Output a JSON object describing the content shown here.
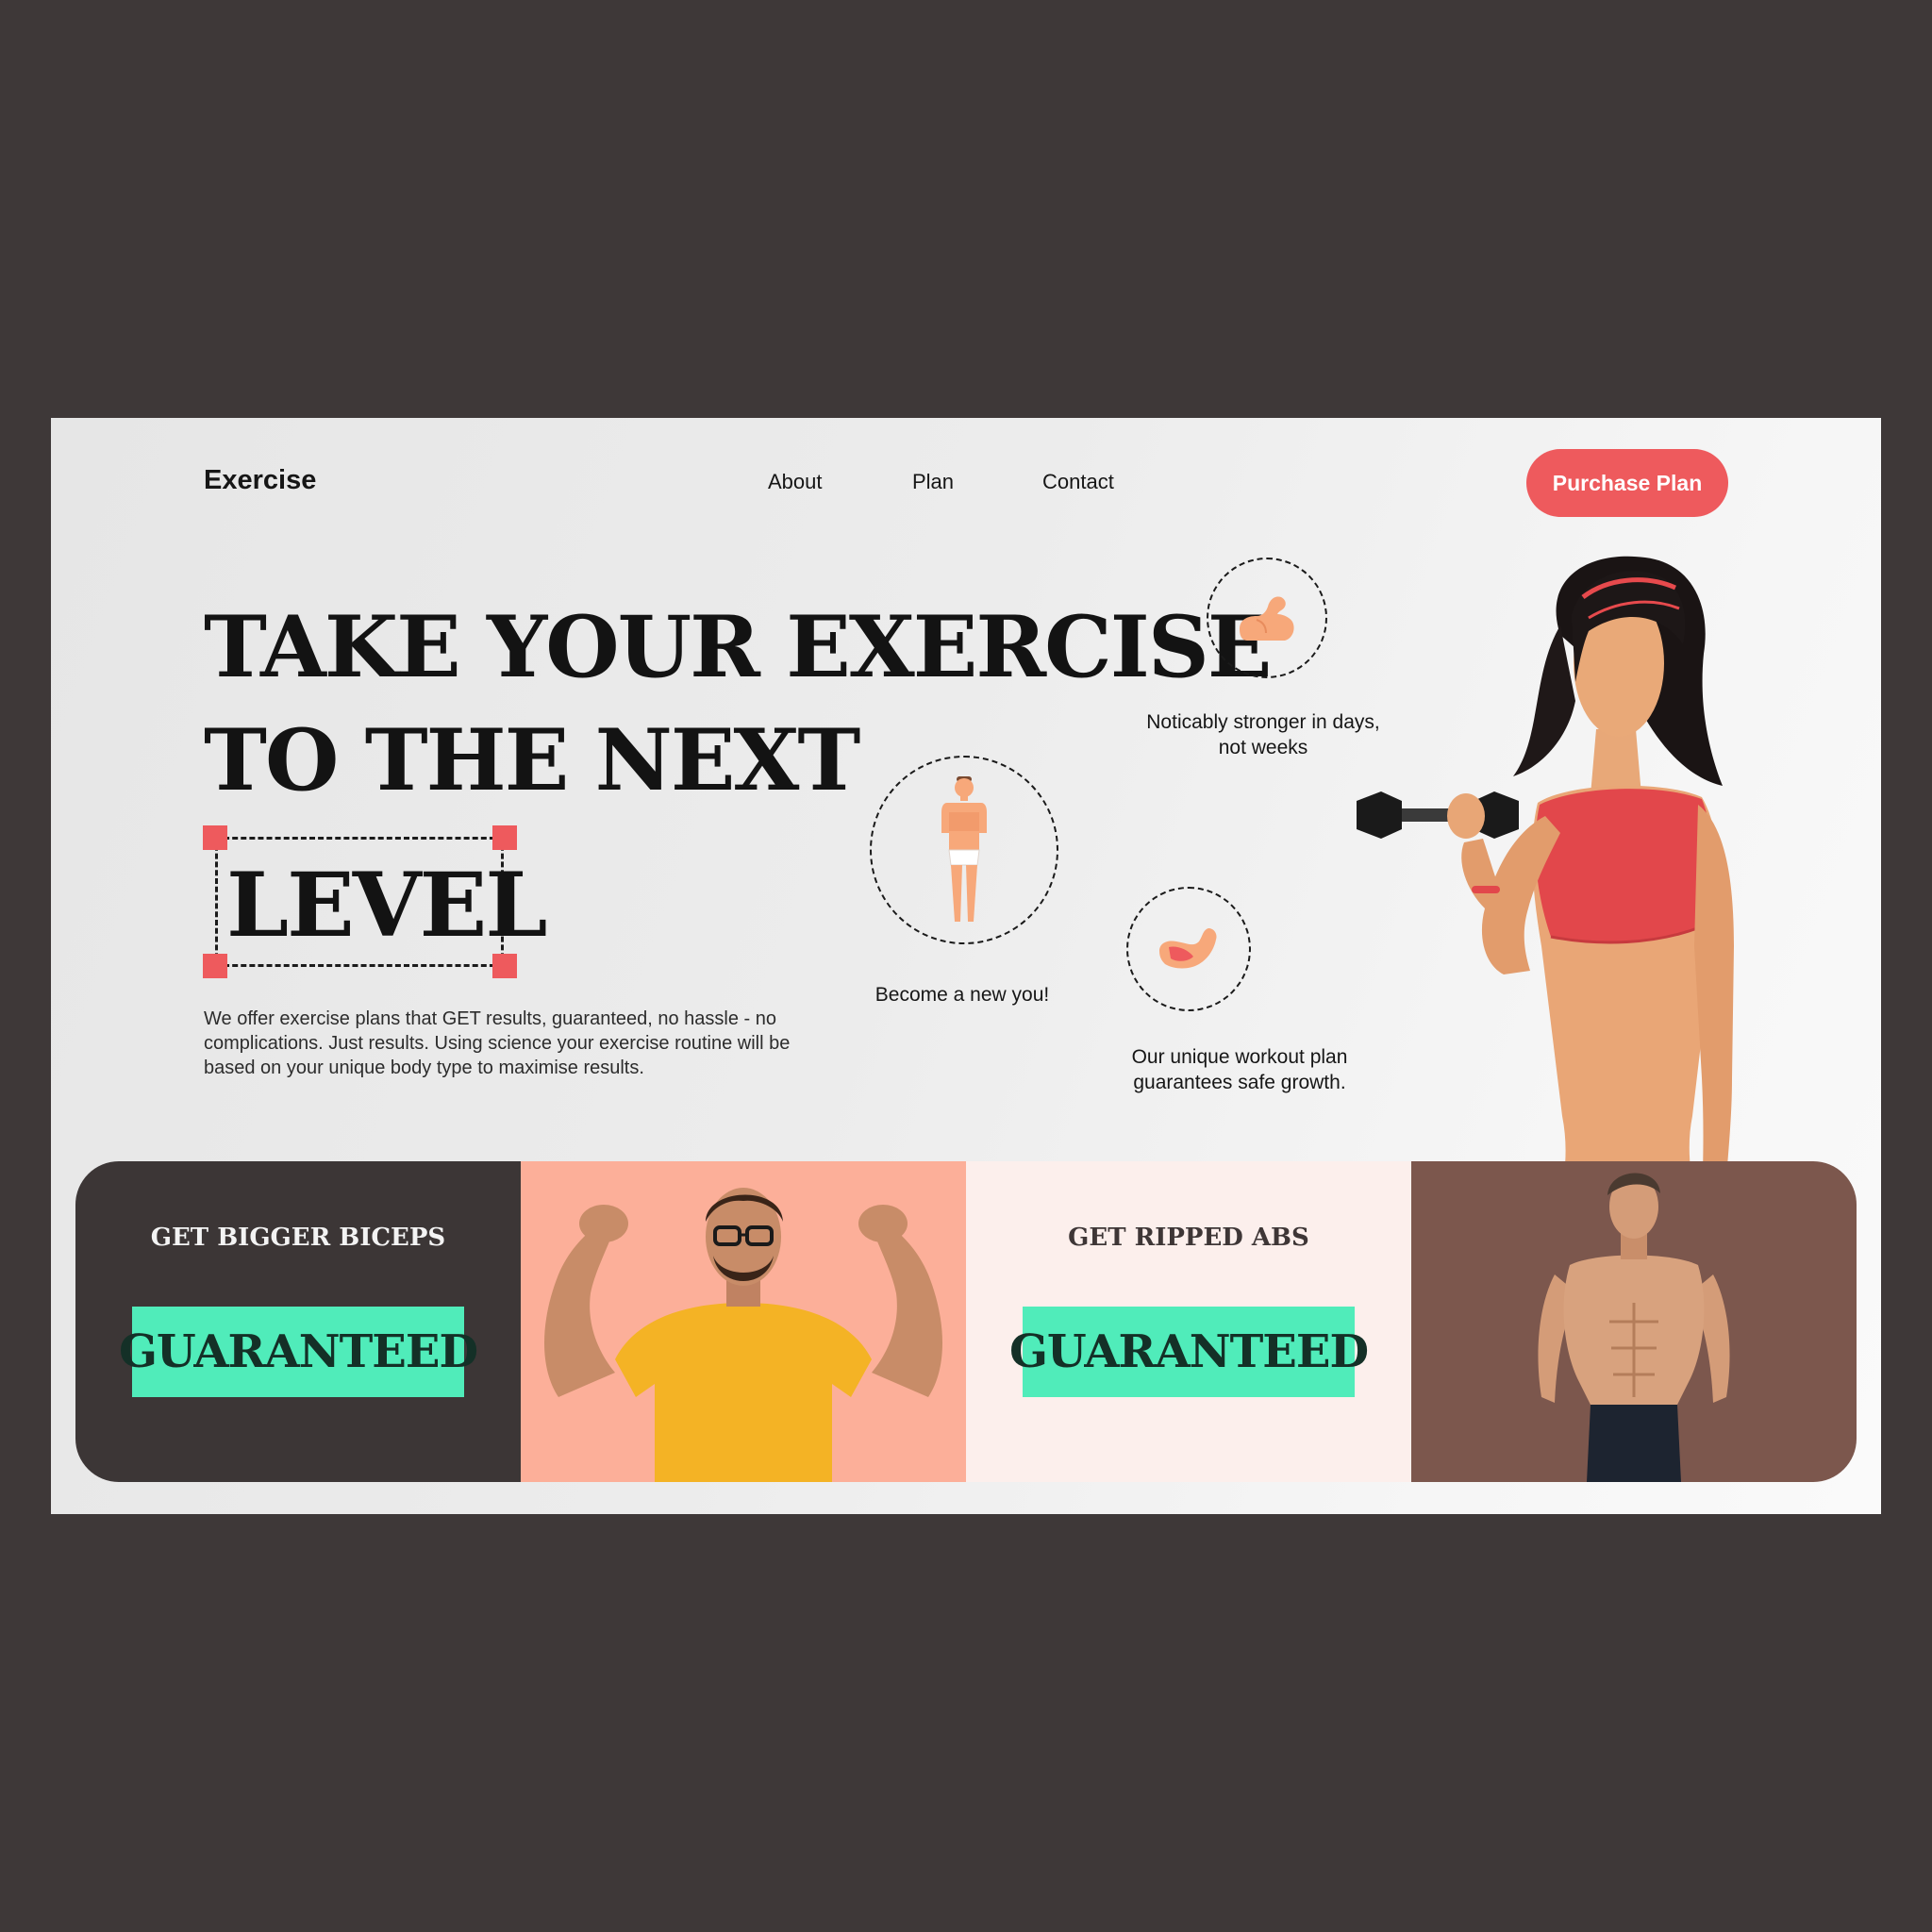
{
  "brand": "Exercise",
  "nav": {
    "about": "About",
    "plan": "Plan",
    "contact": "Contact"
  },
  "cta": "Purchase Plan",
  "hero": {
    "line1": "TAKE YOUR EXERCISE",
    "line2": "TO THE NEXT",
    "highlight": "LEVEL",
    "description": "We offer exercise plans that GET results, guaranteed, no hassle - no complications. Just results. Using science your exercise routine will be based on your unique body type to maximise results."
  },
  "features": [
    {
      "icon": "flexed-bicep-icon",
      "caption_line1": "Noticably stronger in days,",
      "caption_line2": "not weeks"
    },
    {
      "icon": "body-figure-icon",
      "caption_line1": "Become a new you!",
      "caption_line2": ""
    },
    {
      "icon": "arm-muscle-icon",
      "caption_line1": "Our unique workout plan",
      "caption_line2": "guarantees safe growth."
    }
  ],
  "promos": [
    {
      "title": "GET BIGGER BICEPS",
      "badge": "GUARANTEED"
    },
    {
      "title": "GET RIPPED ABS",
      "badge": "GUARANTEED"
    }
  ],
  "colors": {
    "accent": "#ee5a5d",
    "badge": "#50ecba",
    "dark_panel": "#3c3636",
    "peach_panel": "#fcaf99",
    "pink_panel": "#fcefec",
    "brown_panel": "#7c574d",
    "backdrop": "#3e3838"
  }
}
